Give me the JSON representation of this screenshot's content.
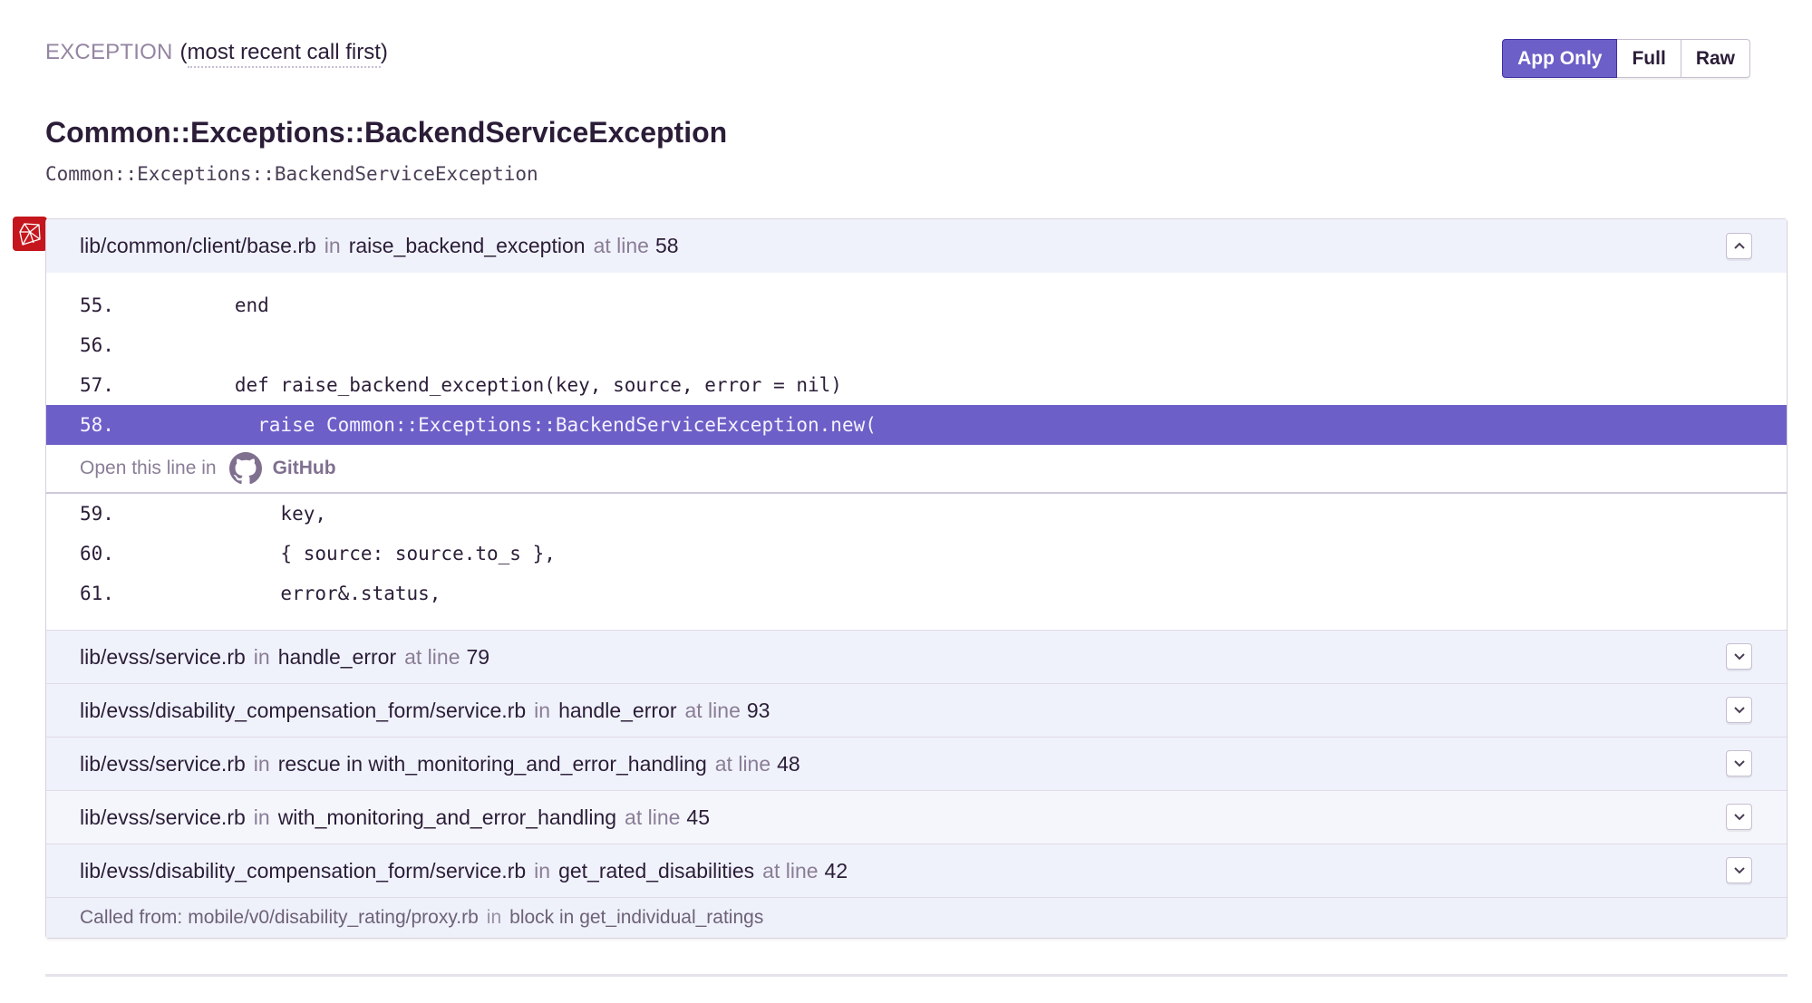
{
  "header": {
    "label": "EXCEPTION",
    "paren_open": "(",
    "order_text": "most recent call first",
    "paren_close": ")"
  },
  "view_toggle": {
    "options": [
      "App Only",
      "Full",
      "Raw"
    ],
    "selected": "App Only"
  },
  "exception": {
    "title": "Common::Exceptions::BackendServiceException",
    "type": "Common::Exceptions::BackendServiceException",
    "platform_icon": "ruby-icon"
  },
  "frames": [
    {
      "file": "lib/common/client/base.rb",
      "in_label": "in",
      "function": "raise_backend_exception",
      "at_line_label": "at line",
      "line": "58",
      "expanded": true,
      "context_before": [
        {
          "no": "55.",
          "code": "      end"
        },
        {
          "no": "56.",
          "code": ""
        },
        {
          "no": "57.",
          "code": "      def raise_backend_exception(key, source, error = nil)"
        }
      ],
      "active_line": {
        "no": "58.",
        "code": "        raise Common::Exceptions::BackendServiceException.new("
      },
      "open_in": {
        "label": "Open this line in",
        "provider": "GitHub"
      },
      "context_after": [
        {
          "no": "59.",
          "code": "          key,"
        },
        {
          "no": "60.",
          "code": "          { source: source.to_s },"
        },
        {
          "no": "61.",
          "code": "          error&.status,"
        }
      ]
    },
    {
      "file": "lib/evss/service.rb",
      "in_label": "in",
      "function": "handle_error",
      "at_line_label": "at line",
      "line": "79",
      "expanded": false
    },
    {
      "file": "lib/evss/disability_compensation_form/service.rb",
      "in_label": "in",
      "function": "handle_error",
      "at_line_label": "at line",
      "line": "93",
      "expanded": false
    },
    {
      "file": "lib/evss/service.rb",
      "in_label": "in",
      "function": "rescue in with_monitoring_and_error_handling",
      "at_line_label": "at line",
      "line": "48",
      "expanded": false
    },
    {
      "file": "lib/evss/service.rb",
      "in_label": "in",
      "function": "with_monitoring_and_error_handling",
      "at_line_label": "at line",
      "line": "45",
      "expanded": false
    },
    {
      "file": "lib/evss/disability_compensation_form/service.rb",
      "in_label": "in",
      "function": "get_rated_disabilities",
      "at_line_label": "at line",
      "line": "42",
      "expanded": false
    }
  ],
  "called_from": {
    "label": "Called from:",
    "file": "mobile/v0/disability_rating/proxy.rb",
    "in_label": "in",
    "function": "block in get_individual_ratings"
  },
  "colors": {
    "accent": "#6c5fc7",
    "frame_header_bg": "#f0f2fb",
    "ruby_red": "#c4161c"
  }
}
